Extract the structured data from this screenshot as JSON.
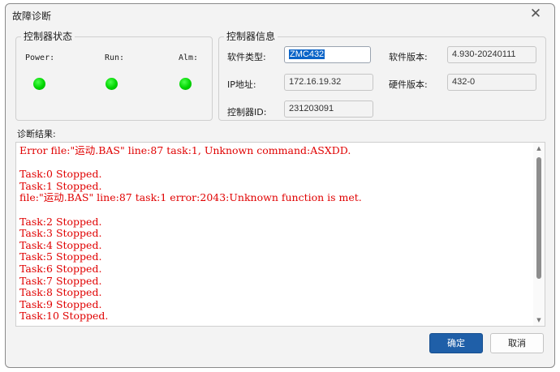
{
  "window": {
    "title": "故障诊断"
  },
  "controller_status": {
    "title": "控制器状态",
    "indicators": [
      {
        "label": "Power:",
        "color": "#00d400"
      },
      {
        "label": "Run:",
        "color": "#00d400"
      },
      {
        "label": "Alm:",
        "color": "#00d400"
      }
    ]
  },
  "controller_info": {
    "title": "控制器信息",
    "software_type": {
      "label": "软件类型:",
      "value": "ZMC432"
    },
    "software_version": {
      "label": "软件版本:",
      "value": "4.930-20240111"
    },
    "ip_address": {
      "label": "IP地址:",
      "value": "172.16.19.32"
    },
    "hardware_version": {
      "label": "硬件版本:",
      "value": "432-0"
    },
    "controller_id": {
      "label": "控制器ID:",
      "value": "231203091"
    }
  },
  "diagnosis": {
    "label": "诊断结果:",
    "lines": [
      "Error file:\"运动.BAS\" line:87 task:1, Unknown command:ASXDD.",
      "",
      "Task:0 Stopped.",
      "Task:1 Stopped.",
      "file:\"运动.BAS\" line:87 task:1 error:2043:Unknown function is met.",
      "",
      "Task:2 Stopped.",
      "Task:3 Stopped.",
      "Task:4 Stopped.",
      "Task:5 Stopped.",
      "Task:6 Stopped.",
      "Task:7 Stopped.",
      "Task:8 Stopped.",
      "Task:9 Stopped.",
      "Task:10 Stopped."
    ]
  },
  "buttons": {
    "ok": "确定",
    "cancel": "取消"
  },
  "colors": {
    "error_text": "#e00000",
    "led_on": "#00d400",
    "primary_button": "#1f5fa8"
  }
}
